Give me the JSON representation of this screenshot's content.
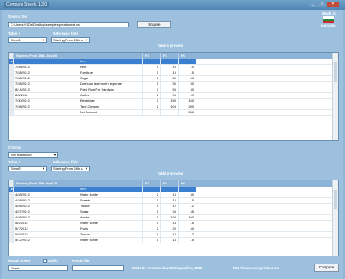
{
  "window": {
    "title": "Compare Sheets 1.3.0",
    "min": "_",
    "max": "□",
    "close": "✕"
  },
  "header": {
    "source_label": "Source file",
    "source_path": "C:\\Users\\YSDs\\Desktop\\sample spreadsheet.xls",
    "browse_label": "Browse",
    "lang_label": "Made in",
    "lang_sub": "BULGARIA",
    "table1_label": "Table 1",
    "ref1_label": "Reference field",
    "table1_value": "Sheet1",
    "ref1_value": "Starting From 28th A",
    "preview1_label": "Table 1 preview"
  },
  "grid1": {
    "columns": [
      "Starting From 28th July 20",
      "F2",
      "F3",
      "F4"
    ],
    "rows": [
      [
        "",
        "Item",
        "",
        "",
        ""
      ],
      [
        "7/28/2012",
        "Rent",
        "1",
        "10",
        "10"
      ],
      [
        "7/28/2012",
        "Furniture",
        "1",
        "15",
        "15"
      ],
      [
        "7/28/2012",
        "Sugar",
        "1",
        "50",
        "50"
      ],
      [
        "7/28/2012",
        "Due loan last month expense",
        "1",
        "50",
        "50"
      ],
      [
        "8/14/2012",
        "Fried Rice For Sandwip",
        "1",
        "50",
        "30"
      ],
      [
        "8/3/2012",
        "Coffee",
        "1",
        "99",
        "99"
      ],
      [
        "7/30/2012",
        "Electrician",
        "1",
        "150",
        "150"
      ],
      [
        "7/28/2012",
        "Tank Cleaner",
        "2",
        "100",
        "200"
      ],
      [
        "",
        "Net Amount",
        "",
        "",
        "550"
      ]
    ]
  },
  "middle": {
    "compare_label": "Criteria",
    "compare_value": "Any that match",
    "table2_label": "Table 2",
    "ref2_label": "Reference field",
    "table2_value": "Sheet2",
    "ref2_value": "Starting From 28th A",
    "preview2_label": "Table 2 preview"
  },
  "grid2": {
    "columns": [
      "Starting From 28th April 20",
      "F2",
      "F3",
      "F4"
    ],
    "rows": [
      [
        "",
        "Item",
        "",
        "",
        ""
      ],
      [
        "4/28/2012",
        "Water Bottle",
        "2",
        "15",
        "30"
      ],
      [
        "4/28/2012",
        "Sweets",
        "1",
        "15",
        "15"
      ],
      [
        "4/28/2012",
        "Tissue",
        "1",
        "12",
        "12"
      ],
      [
        "4/27/2012",
        "Sugar",
        "1",
        "45",
        "45"
      ],
      [
        "4/28/2012",
        "Auntie",
        "1",
        "100",
        "100"
      ],
      [
        "5/4/2012",
        "Water Bottle",
        "1",
        "15",
        "15"
      ],
      [
        "5/7/2012",
        "Fruits",
        "2",
        "20",
        "40"
      ],
      [
        "5/8/2012",
        "Tissue",
        "1",
        "12",
        "12"
      ],
      [
        "5/12/2012",
        "Water Bottle",
        "1",
        "15",
        "15"
      ]
    ]
  },
  "footer": {
    "result_sheet_label": "Result Sheet",
    "suffix_label": "suffix",
    "result_file_label": "Result file",
    "result_sheet_value": "Result",
    "credit": "Made by Venkateshan Mahaprabhu, 2012",
    "website": "http://www.easyprintx.com",
    "compare_label": "Compare"
  },
  "colors": {
    "window_bg": "#9cc0de",
    "selection": "#3a7fd0",
    "header_bg": "#8db4d6"
  }
}
